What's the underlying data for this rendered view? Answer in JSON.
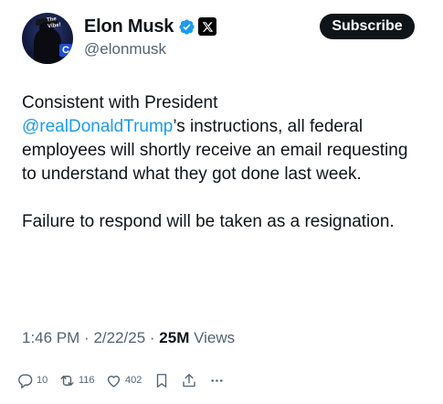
{
  "author": {
    "display_name": "Elon Musk",
    "handle": "@elonmusk",
    "verified_icon": "verified-badge-icon",
    "affiliation_icon": "x-logo-icon",
    "avatar_letter": "C",
    "avatar_sign": "The Vibe!"
  },
  "subscribe": {
    "label": "Subscribe"
  },
  "tweet": {
    "line1_before": "Consistent with President",
    "mention": "@realDonaldTrump",
    "line1_after": "’s instructions, all federal employees will shortly receive an email requesting to understand what they got done last week.",
    "paragraph2": "Failure to respond will be taken as a resignation."
  },
  "meta": {
    "time": "1:46 PM",
    "date": "2/22/25",
    "separator": " · ",
    "views_count": "25M",
    "views_label": "Views"
  },
  "actions": {
    "reply_count": "10",
    "repost_count": "116",
    "like_count": "402"
  },
  "colors": {
    "accent": "#1d9bf0",
    "text": "#0f1419",
    "muted": "#536471"
  }
}
